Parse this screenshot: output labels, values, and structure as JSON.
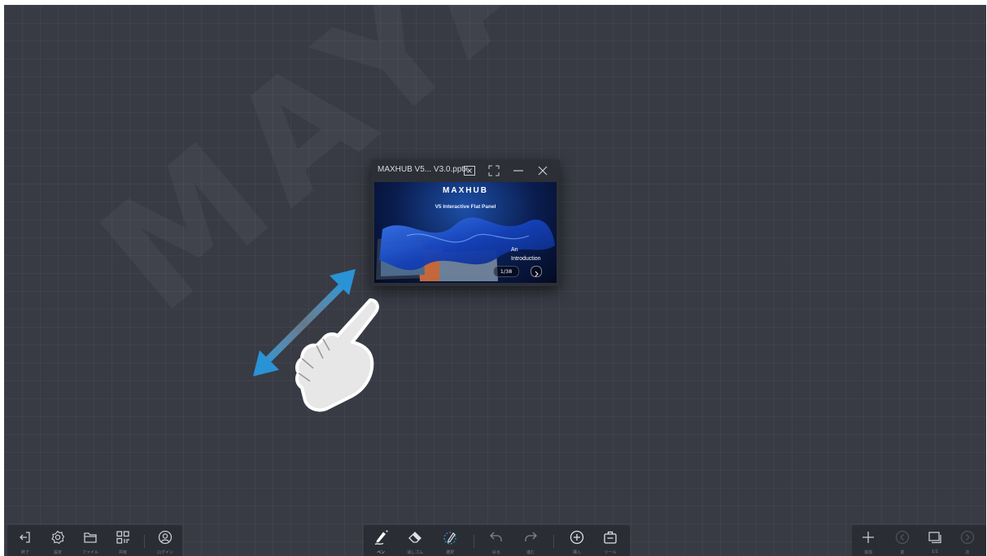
{
  "watermark": "MAYA S",
  "ppt_window": {
    "title": "MAXHUB V5... V3.0.pptx",
    "controls": [
      "excel-icon",
      "fullscreen-icon",
      "minimize-icon",
      "close-icon"
    ],
    "slide": {
      "brand": "MAXHUB",
      "subtitle": "V5 Interactive Flat Panel",
      "intro_line1": "An",
      "intro_line2": "Introduction",
      "page_indicator": "1/38"
    }
  },
  "left_toolbar": [
    {
      "icon": "exit-icon",
      "label": "終了"
    },
    {
      "icon": "gear-icon",
      "label": "設定"
    },
    {
      "icon": "folder-icon",
      "label": "ファイル"
    },
    {
      "icon": "qr-code-icon",
      "label": "共有"
    },
    {
      "icon": "user-icon",
      "label": "ログイン"
    }
  ],
  "center_toolbar": [
    {
      "icon": "pen-icon",
      "label": "ペン",
      "active": true
    },
    {
      "icon": "eraser-icon",
      "label": "消しゴム"
    },
    {
      "icon": "lasso-select-icon",
      "label": "選択"
    },
    {
      "icon": "undo-icon",
      "label": "戻る"
    },
    {
      "icon": "redo-icon",
      "label": "進む"
    },
    {
      "icon": "insert-plus-icon",
      "label": "挿入"
    },
    {
      "icon": "toolbox-icon",
      "label": "ツール"
    }
  ],
  "right_toolbar": [
    {
      "icon": "add-page-icon",
      "label": "追加"
    },
    {
      "icon": "previous-page-icon",
      "label": "前"
    },
    {
      "icon": "pages-icon",
      "label": "1/1"
    },
    {
      "icon": "next-page-icon",
      "label": "次"
    }
  ],
  "colors": {
    "canvas": "#383b44",
    "toolbar": "#2a2d33",
    "accent_blue": "#2a93d5",
    "icon": "#c9ccd2"
  }
}
